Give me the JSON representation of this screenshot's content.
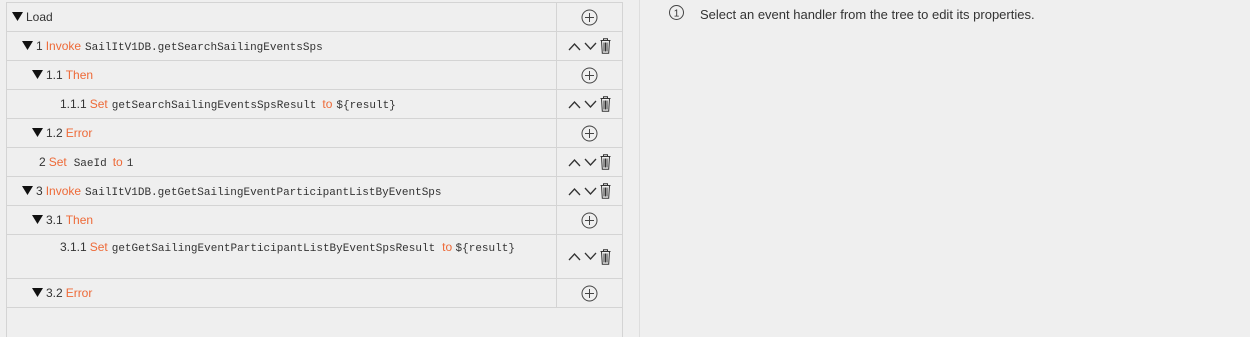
{
  "tree": {
    "root_label": "Load",
    "rows": [
      {
        "num": "1",
        "kw": "Invoke",
        "code": "SailItV1DB.getSearchSailingEventsSps"
      },
      {
        "num": "1.1",
        "kw": "Then"
      },
      {
        "num": "1.1.1",
        "kw": "Set",
        "code": "getSearchSailingEventsSpsResult",
        "kw2": "to",
        "code2": "${result}"
      },
      {
        "num": "1.2",
        "kw": "Error"
      },
      {
        "num": "2",
        "kw": "Set",
        "code": "SaeId",
        "kw2": "to",
        "code2": "1"
      },
      {
        "num": "3",
        "kw": "Invoke",
        "code": "SailItV1DB.getGetSailingEventParticipantListByEventSps"
      },
      {
        "num": "3.1",
        "kw": "Then"
      },
      {
        "num": "3.1.1",
        "kw": "Set",
        "code": "getGetSailingEventParticipantListByEventSpsResult",
        "kw2": "to",
        "code2": "${result}"
      },
      {
        "num": "3.2",
        "kw": "Error"
      }
    ]
  },
  "info": {
    "icon": "info-circle-icon",
    "text": "Select an event handler from the tree to edit its properties."
  },
  "colors": {
    "keyword": "#ee6a38",
    "text": "#333333",
    "border": "#d4d4d4",
    "background": "#efefef"
  }
}
